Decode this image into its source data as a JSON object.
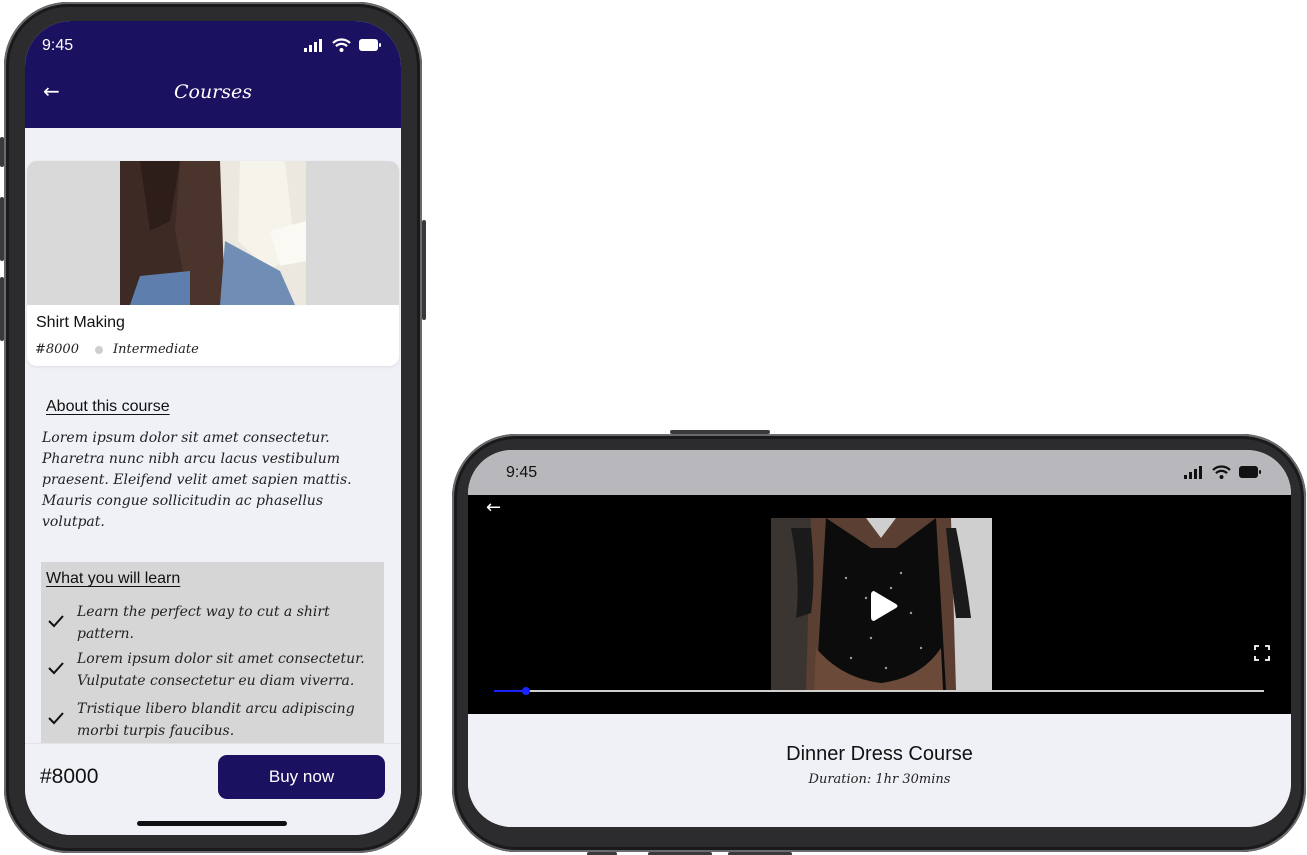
{
  "portrait": {
    "status": {
      "time": "9:45"
    },
    "header": {
      "title": "Courses"
    },
    "course": {
      "name": "Shirt Making",
      "price": "#8000",
      "level": "Intermediate"
    },
    "about": {
      "heading": "About this course",
      "text": "Lorem ipsum dolor sit amet consectetur. Pharetra nunc nibh arcu lacus vestibulum praesent. Eleifend velit amet sapien mattis. Mauris congue sollicitudin ac phasellus volutpat."
    },
    "learn": {
      "heading": "What you will learn",
      "items": [
        "Learn the perfect way to cut a shirt pattern.",
        "Lorem ipsum dolor sit amet consectetur. Vulputate consectetur eu diam viverra.",
        "Tristique libero blandit arcu adipiscing morbi turpis faucibus."
      ]
    },
    "bottom_bar": {
      "price": "#8000",
      "buy_label": "Buy now"
    }
  },
  "landscape": {
    "status": {
      "time": "9:45"
    },
    "video": {
      "progress": 0.042
    },
    "info": {
      "title": "Dinner Dress Course",
      "duration": "Duration: 1hr 30mins"
    }
  },
  "colors": {
    "brand": "#1a1160",
    "background": "#f0f1f6",
    "progress": "#1a22ff",
    "learn_box": "#d6d6d6"
  },
  "icons": [
    "back-arrow-icon",
    "signal-icon",
    "wifi-icon",
    "battery-icon",
    "checkmark-icon",
    "play-icon",
    "fullscreen-icon"
  ]
}
